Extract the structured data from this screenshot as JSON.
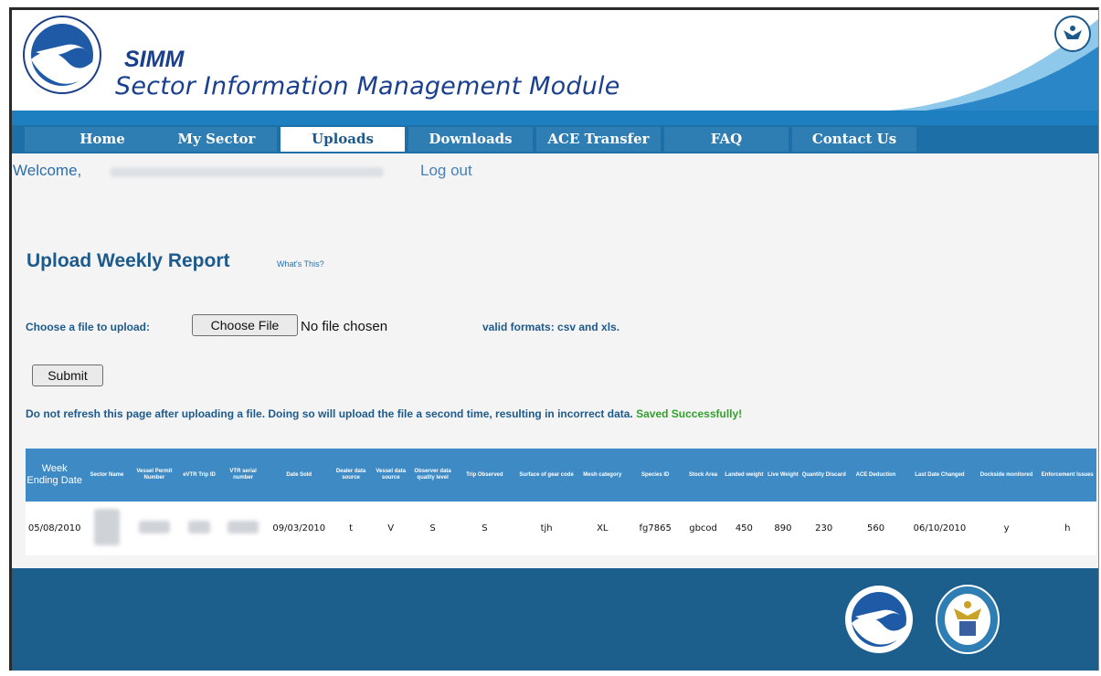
{
  "header": {
    "title": "SIMM",
    "subtitle": "Sector Information Management Module",
    "logo_text": "NOAA"
  },
  "nav": {
    "items": [
      "Home",
      "My Sector",
      "Uploads",
      "Downloads",
      "ACE Transfer",
      "FAQ",
      "Contact Us"
    ],
    "active": "Uploads"
  },
  "welcome": {
    "label": "Welcome,",
    "logout": "Log out"
  },
  "upload": {
    "title": "Upload Weekly Report",
    "whats_this": "What's This?",
    "choose_label": "Choose a file to upload:",
    "choose_button": "Choose File",
    "no_file": "No file chosen",
    "valid_formats": "valid formats: csv and xls.",
    "submit": "Submit",
    "warning": "Do not refresh this page after uploading a file. Doing so will upload the file a second time, resulting in incorrect data.",
    "saved": "Saved Successfully!"
  },
  "table": {
    "headers": [
      "Week Ending Date",
      "Sector Name",
      "Vessel Permit Number",
      "eVTR Trip ID",
      "VTR serial number",
      "Date Sold",
      "Dealer data source",
      "Vessel data source",
      "Observer data quality level",
      "Trip Observed",
      "Surface of gear code",
      "Mesh category",
      "Species ID",
      "Stock Area",
      "Landed weight",
      "Live Weight",
      "Quantity Discard",
      "ACE Deduction",
      "Last Date Changed",
      "Dockside monitored",
      "Enforcement Issues"
    ],
    "row": [
      "05/08/2010",
      "",
      "",
      "",
      "",
      "09/03/2010",
      "t",
      "V",
      "S",
      "S",
      "tjh",
      "XL",
      "fg7865",
      "gbcod",
      "450",
      "890",
      "230",
      "560",
      "06/10/2010",
      "y",
      "h"
    ]
  },
  "colors": {
    "primary": "#1d5a8c",
    "nav": "#1d6fa8",
    "table_header": "#3e8ac4",
    "success": "#33a02c"
  }
}
